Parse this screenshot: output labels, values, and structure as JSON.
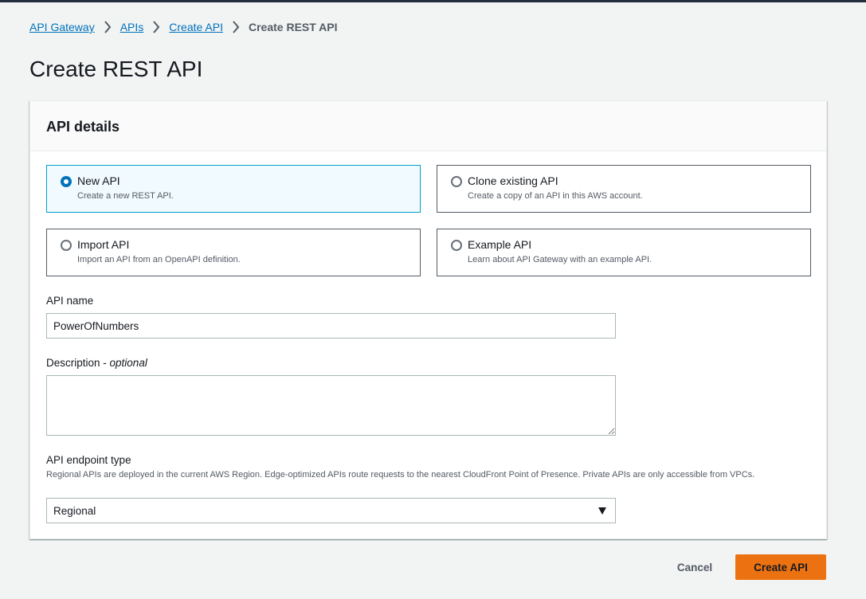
{
  "breadcrumbs": {
    "items": [
      {
        "label": "API Gateway"
      },
      {
        "label": "APIs"
      },
      {
        "label": "Create API"
      }
    ],
    "current": "Create REST API"
  },
  "page": {
    "title": "Create REST API"
  },
  "panel": {
    "title": "API details",
    "options": [
      {
        "label": "New API",
        "description": "Create a new REST API.",
        "selected": true
      },
      {
        "label": "Clone existing API",
        "description": "Create a copy of an API in this AWS account.",
        "selected": false
      },
      {
        "label": "Import API",
        "description": "Import an API from an OpenAPI definition.",
        "selected": false
      },
      {
        "label": "Example API",
        "description": "Learn about API Gateway with an example API.",
        "selected": false
      }
    ],
    "api_name": {
      "label": "API name",
      "value": "PowerOfNumbers"
    },
    "description": {
      "label": "Description - ",
      "optional": "optional",
      "value": ""
    },
    "endpoint_type": {
      "label": "API endpoint type",
      "help": "Regional APIs are deployed in the current AWS Region. Edge-optimized APIs route requests to the nearest CloudFront Point of Presence. Private APIs are only accessible from VPCs.",
      "value": "Regional"
    }
  },
  "actions": {
    "cancel_label": "Cancel",
    "create_label": "Create API"
  },
  "colors": {
    "accent": "#0073bb",
    "primary_button": "#ec7211",
    "selected_border": "#00a1c9",
    "topbar": "#232f3e"
  }
}
